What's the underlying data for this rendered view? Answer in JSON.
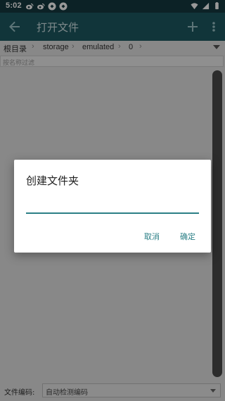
{
  "status_bar": {
    "time": "5:02",
    "left_icons": [
      "weibo-icon",
      "weibo-icon",
      "sync-icon",
      "sync-icon"
    ],
    "right_icons": [
      "wifi-icon",
      "signal-icon",
      "battery-icon"
    ]
  },
  "app_bar": {
    "title": "打开文件"
  },
  "breadcrumb": {
    "items": [
      "根目录",
      "storage",
      "emulated",
      "0"
    ]
  },
  "filter": {
    "placeholder": "按名称过滤"
  },
  "encoding": {
    "label": "文件编码:",
    "value": "自动检测编码"
  },
  "dialog": {
    "title": "创建文件夹",
    "input_value": "",
    "cancel_label": "取消",
    "ok_label": "确定"
  },
  "colors": {
    "status_bar": "#143a40",
    "app_bar": "#1d5962",
    "accent": "#2b7f86"
  }
}
